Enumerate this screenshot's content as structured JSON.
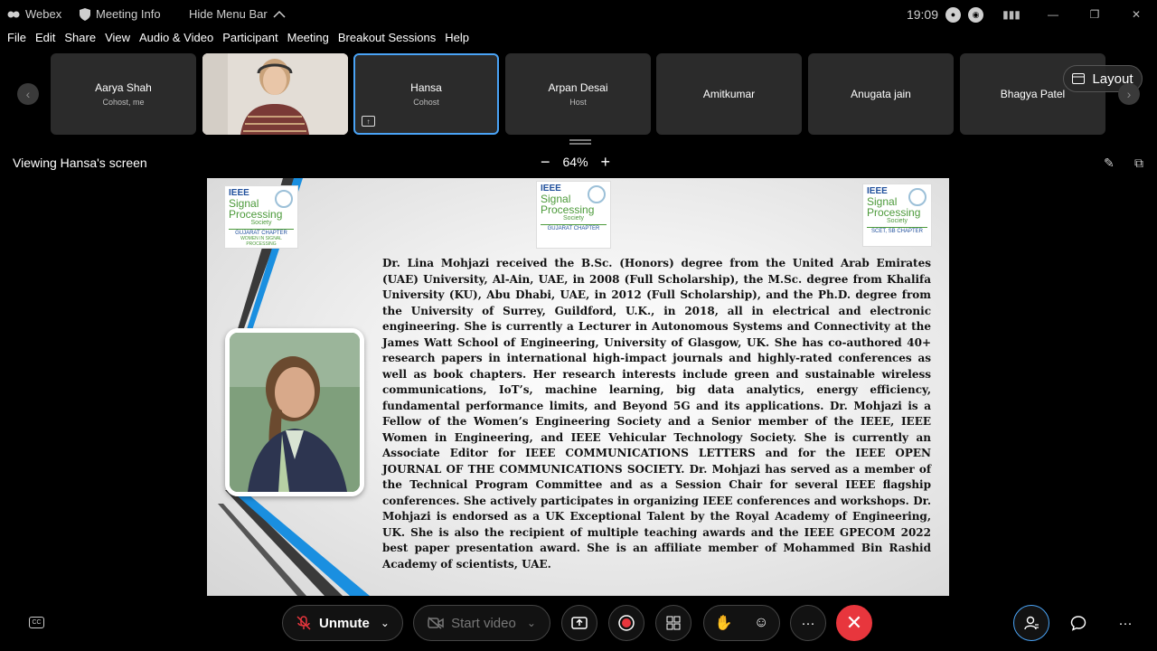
{
  "titlebar": {
    "app_name": "Webex",
    "meeting_info": "Meeting Info",
    "hide_menu_bar": "Hide Menu Bar",
    "time": "19:09"
  },
  "menu": [
    "File",
    "Edit",
    "Share",
    "View",
    "Audio & Video",
    "Participant",
    "Meeting",
    "Breakout Sessions",
    "Help"
  ],
  "participants": [
    {
      "name": "Aarya Shah",
      "role": "Cohost, me"
    },
    {
      "name": "",
      "role": ""
    },
    {
      "name": "Hansa",
      "role": "Cohost"
    },
    {
      "name": "Arpan Desai",
      "role": "Host"
    },
    {
      "name": "Amitkumar",
      "role": ""
    },
    {
      "name": "Anugata jain",
      "role": ""
    },
    {
      "name": "Bhagya Patel",
      "role": ""
    }
  ],
  "layout_label": "Layout",
  "viewing": "Viewing Hansa's screen",
  "zoom_level": "64%",
  "slide": {
    "logos": [
      {
        "l1": "IEEE",
        "l2a": "Signal",
        "l2b": "Processing",
        "l3": "Society",
        "chapter": "GUJARAT CHAPTER",
        "sub": "WOMEN IN SIGNAL PROCESSING"
      },
      {
        "l1": "IEEE",
        "l2a": "Signal",
        "l2b": "Processing",
        "l3": "Society",
        "chapter": "GUJARAT CHAPTER",
        "sub": ""
      },
      {
        "l1": "IEEE",
        "l2a": "Signal",
        "l2b": "Processing",
        "l3": "Society",
        "chapter": "SCET, SB CHAPTER",
        "sub": ""
      }
    ],
    "bio": "Dr. Lina Mohjazi received the B.Sc. (Honors) degree from the United Arab Emirates (UAE) University, Al-Ain, UAE, in 2008 (Full Scholarship), the M.Sc. degree from Khalifa University (KU), Abu Dhabi, UAE, in 2012 (Full Scholarship), and the Ph.D. degree from the University of Surrey, Guildford, U.K., in 2018, all in electrical and electronic engineering. She is currently a Lecturer in Autonomous Systems and Connectivity at the James Watt School of Engineering, University of Glasgow, UK. She has co-authored 40+ research papers in international high-impact journals and highly-rated conferences as well as book chapters. Her research interests include green and sustainable wireless communications, IoT’s, machine learning, big data analytics, energy efficiency, fundamental performance limits, and Beyond 5G and its applications. Dr. Mohjazi is a Fellow of the Women’s Engineering Society and a Senior member of the IEEE, IEEE Women in Engineering, and IEEE Vehicular Technology Society. She is currently an Associate Editor for IEEE COMMUNICATIONS LETTERS and for the IEEE OPEN JOURNAL OF THE COMMUNICATIONS SOCIETY. Dr. Mohjazi has served as a member of the Technical Program Committee and as a Session Chair for several IEEE flagship conferences. She actively participates in organizing IEEE conferences and workshops. Dr. Mohjazi is endorsed as a UK Exceptional Talent by the Royal Academy of Engineering, UK. She is also the recipient of multiple teaching awards and the IEEE GPECOM 2022 best paper presentation award. She is an affiliate member of Mohammed Bin Rashid Academy of scientists, UAE."
  },
  "controls": {
    "unmute": "Unmute",
    "start_video": "Start video"
  },
  "colors": {
    "accent_blue": "#4aa3f5",
    "leave_red": "#e8363d",
    "slide_blue": "#1a8fe0",
    "slide_dark": "#3a3a3a"
  }
}
